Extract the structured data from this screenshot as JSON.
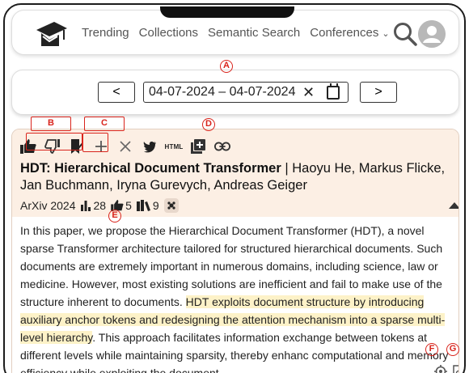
{
  "nav": {
    "links": [
      "Trending",
      "Collections",
      "Semantic Search"
    ],
    "dropdown_label": "Conferences"
  },
  "datebar": {
    "prev_label": "<",
    "next_label": ">",
    "date_range": "04-07-2024 – 04-07-2024",
    "clear_label": "✕"
  },
  "markers": {
    "A": "A",
    "B": "B",
    "C": "C",
    "D": "D",
    "E": "E",
    "F": "F",
    "G": "G"
  },
  "paper": {
    "title": "HDT: Hierarchical Document Transformer",
    "separator": " | ",
    "authors": "Haoyu He, Markus Flicke, Jan Buchmann, Iryna Gurevych, Andreas Geiger",
    "venue": "ArXiv 2024",
    "stats": {
      "views": "28",
      "likes": "5",
      "library": "9"
    },
    "toolbar": {
      "html_label": "HTML"
    },
    "abstract_before": "In this paper, we propose the Hierarchical Document Transformer (HDT), a novel sparse Transformer architecture tailored for structured hierarchical documents. Such documents are extremely important in numerous domains, including science, law or medicine. However, most existing solutions are inefficient and fail to make use of the structure inherent to documents. ",
    "abstract_highlight": "HDT exploits document structure by introducing auxiliary anchor tokens and redesigning the attention mechanism into a sparse multi-level hierarchy",
    "abstract_after": ". This approach facilitates information exchange between tokens at different levels while maintaining sparsity, thereby enhanc computational and memory efficiency while exploiting the document..."
  },
  "colors": {
    "accent_red": "#d9241c",
    "card_header_bg": "#fcefe4",
    "highlight_bg": "#fdf2c8"
  }
}
